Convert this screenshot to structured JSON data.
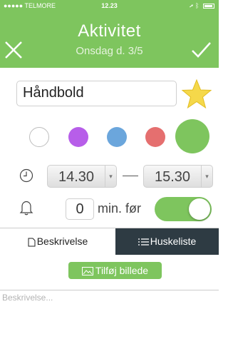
{
  "status_bar": {
    "carrier": "●●●●● TELMORE",
    "time": "12.23"
  },
  "header": {
    "title": "Aktivitet",
    "subtitle": "Onsdag d. 3/5"
  },
  "activity": {
    "name": "Håndbold",
    "favorite": true
  },
  "colors": [
    "#ffffff",
    "#b75ee9",
    "#6ba6dc",
    "#e56f6f",
    "#7ec55e"
  ],
  "selected_color": "#7ec55e",
  "time": {
    "start": "14.30",
    "end": "15.30"
  },
  "reminder": {
    "minutes": "0",
    "label": "min. før",
    "enabled": true
  },
  "tabs": {
    "description": "Beskrivelse",
    "checklist": "Huskeliste",
    "active": "checklist"
  },
  "add_image_label": "Tilføj billede",
  "description_placeholder": "Beskrivelse..."
}
